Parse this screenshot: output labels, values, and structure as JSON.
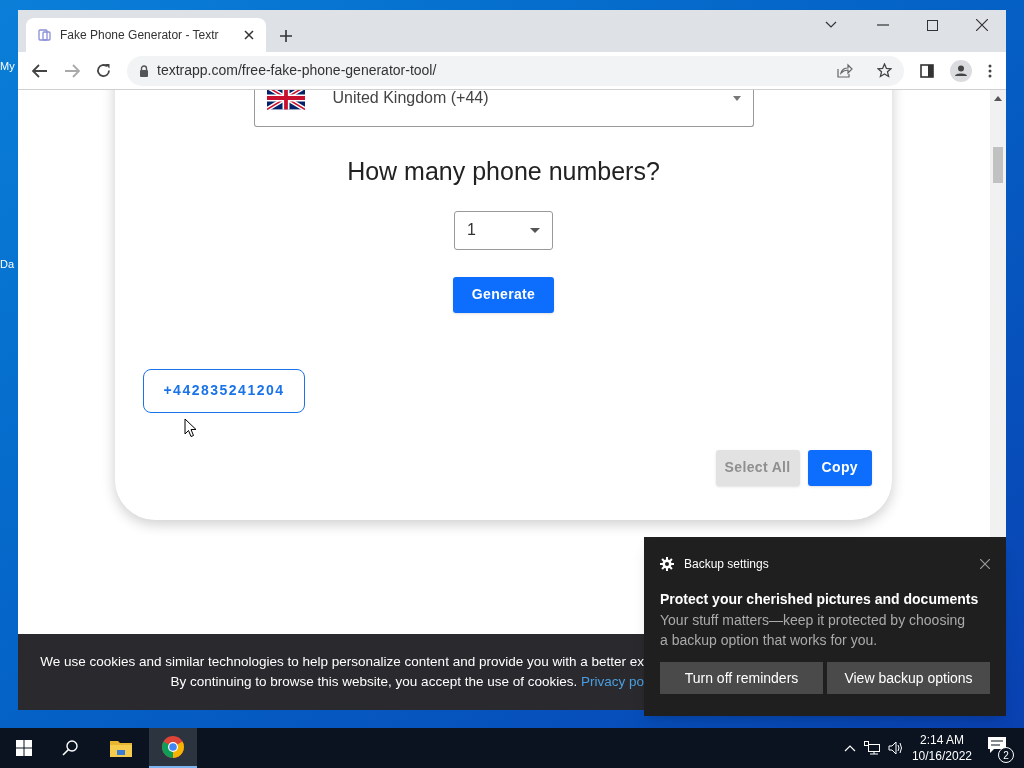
{
  "desktop_icons": [
    {
      "label": "My"
    },
    {
      "label": "Da"
    }
  ],
  "browser": {
    "tab_title": "Fake Phone Generator - Textr",
    "url": "textrapp.com/free-fake-phone-generator-tool/"
  },
  "page": {
    "country": "United Kingdom (+44)",
    "heading": "How many phone numbers?",
    "count": "1",
    "generate": "Generate",
    "numbers": [
      "+442835241204"
    ],
    "actions": [
      {
        "label": "Select All",
        "disabled": true
      },
      {
        "label": "Copy",
        "disabled": false
      }
    ]
  },
  "cookie_banner": {
    "line_1": "We use cookies and similar technologies to help personalize content and provide you with a better ex",
    "line_2": "By continuing to browse this website, you accept the use of cookies. ",
    "link": "Privacy po"
  },
  "toast": {
    "app": "Backup settings",
    "title": "Protect your cherished pictures and documents",
    "body": "Your stuff matters—keep it protected by choosing a backup option that works for you.",
    "buttons": [
      "Turn off reminders",
      "View backup options"
    ]
  },
  "taskbar": {
    "time": "2:14 AM",
    "date": "10/16/2022",
    "notifications": "2"
  }
}
